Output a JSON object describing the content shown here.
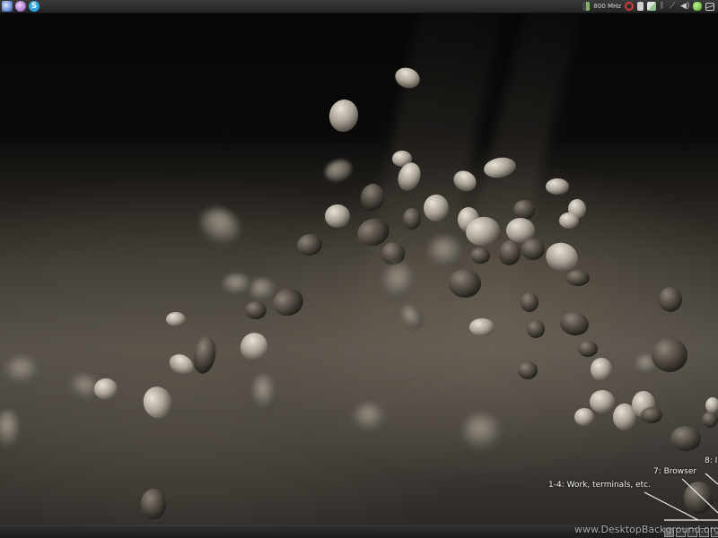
{
  "top_panel": {
    "launchers": [
      {
        "icon": "web-browser-icon",
        "color": "#6a8fd0"
      },
      {
        "icon": "messenger-icon",
        "color": "#b07ad0"
      },
      {
        "icon": "skype-icon",
        "color": "#2aa5e0"
      }
    ],
    "cpu_frequency": "800 MHz",
    "tray_icons": [
      {
        "icon": "cpu-meter-icon",
        "color": "#7fb36a"
      },
      {
        "icon": "stop-sign-icon",
        "color": "#d43a3a"
      },
      {
        "icon": "clipboard-icon",
        "color": "#cfcfcf"
      },
      {
        "icon": "update-notifier-icon",
        "color": "#8fc48f"
      },
      {
        "icon": "bluetooth-icon",
        "color": "#bbbbbb"
      },
      {
        "icon": "network-icon",
        "color": "#bbbbbb"
      },
      {
        "icon": "volume-icon",
        "color": "#cccccc"
      },
      {
        "icon": "pidgin-icon",
        "color": "#77c24a"
      },
      {
        "icon": "mail-icon",
        "color": "#cfcfcf"
      }
    ]
  },
  "annotations": {
    "work": "1-4: Work, terminals, etc.",
    "browser": "7: Browser",
    "eight": "8: I"
  },
  "workspaces": {
    "count": 6,
    "active_index": 0
  },
  "watermark": "www.DesktopBackground.org",
  "colors": {
    "panel": "#2a2a2a",
    "pebble_light": "#c9c2b6",
    "pebble_dark": "#5a544c"
  }
}
